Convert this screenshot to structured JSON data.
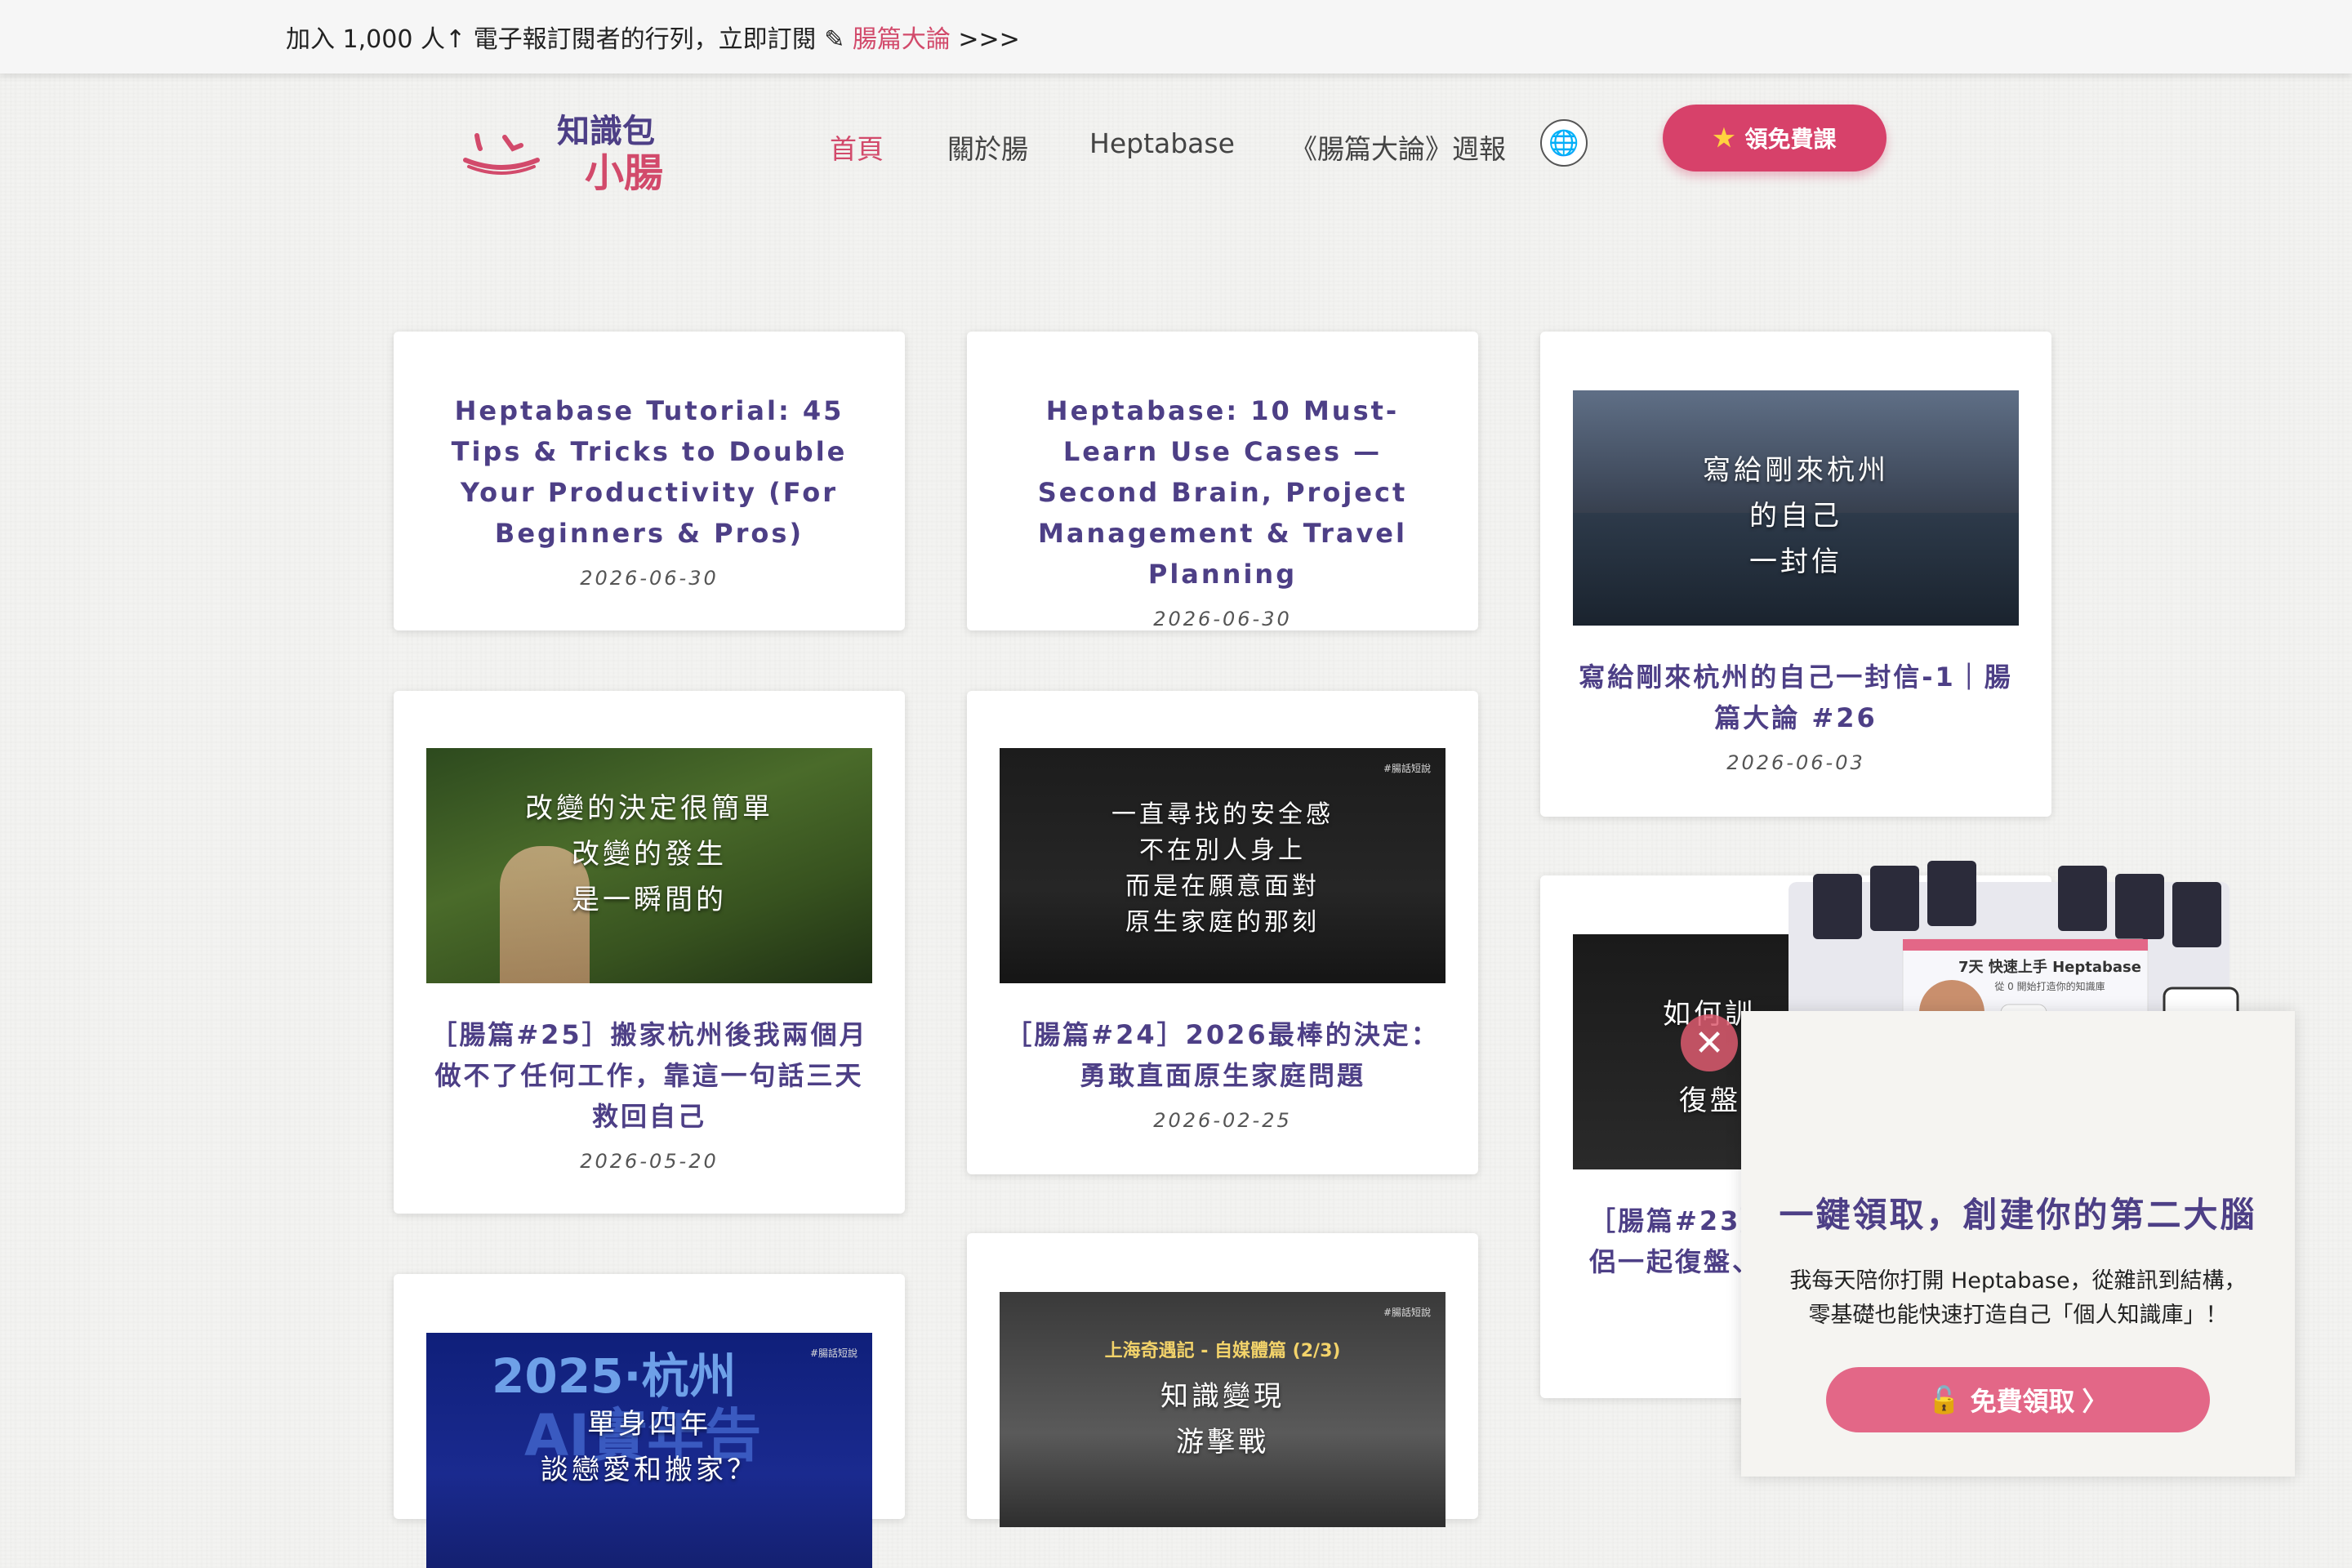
{
  "announcement": {
    "text": "加入 1,000 人↑ 電子報訂閱者的行列，立即訂閱 ✎ ",
    "link": "腸篇大論",
    "arrows": " >>>"
  },
  "logo": {
    "line1": "知識包",
    "line2": "小腸"
  },
  "nav": {
    "home": "首頁",
    "about": "關於腸",
    "heptabase": "Heptabase",
    "weekly": "《腸篇大論》週報",
    "globe_icon": "globe-icon",
    "cta": "領免費課"
  },
  "posts": [
    {
      "title": "Heptabase Tutorial: 45 Tips & Tricks to Double Your Productivity (For Beginners & Pros)",
      "date": "2026-06-30"
    },
    {
      "title": "Heptabase: 10 Must-Learn Use Cases — Second Brain, Project Management & Travel Planning",
      "date": "2026-06-30"
    },
    {
      "title": "寫給剛來杭州的自己一封信-1｜腸篇大論 #26",
      "date": "2026-06-03",
      "thumb_lines": [
        "寫給剛來杭州",
        "的自己",
        "一封信"
      ]
    },
    {
      "title": "［腸篇#25］搬家杭州後我兩個月做不了任何工作，靠這一句話三天救回自己",
      "date": "2026-05-20",
      "thumb_lines": [
        "改變的決定很簡單",
        "改變的發生",
        "是一瞬間的"
      ]
    },
    {
      "title": "［腸篇#24］2026最棒的決定：勇敢直面原生家庭問題",
      "date": "2026-02-25",
      "thumb_tag": "#腸話短說",
      "thumb_lines": [
        "一直尋找的安全感",
        "不在別人身上",
        "而是在願意面對",
        "原生家庭的那刻"
      ]
    },
    {
      "title_partial": "［腸篇#23］",
      "title_partial2": "侶一起復盤、",
      "thumb_lines": [
        "如何訓",
        "復盤"
      ]
    },
    {
      "thumb_title": "2025·杭州",
      "thumb_sub": "AI實年告",
      "thumb_lines": [
        "單身四年",
        "談戀愛和搬家？"
      ],
      "thumb_tag": "#腸話短說"
    },
    {
      "thumb_title": "上海奇遇記 - 自媒體篇 (2/3)",
      "thumb_lines": [
        "知識變現",
        "游擊戰"
      ],
      "thumb_tag": "#腸話短說"
    }
  ],
  "popup": {
    "title": "一鍵領取，創建你的第二大腦",
    "desc_line1": "我每天陪你打開 Heptabase，從雜訊到結構，",
    "desc_line2": "零基礎也能快速打造自己「個人知識庫」！",
    "button": "免費領取 〉",
    "close": "✕",
    "promo_heading": "7天 快速上手 Heptabase",
    "promo_sub": "從 0 開始打造你的知識庫"
  }
}
